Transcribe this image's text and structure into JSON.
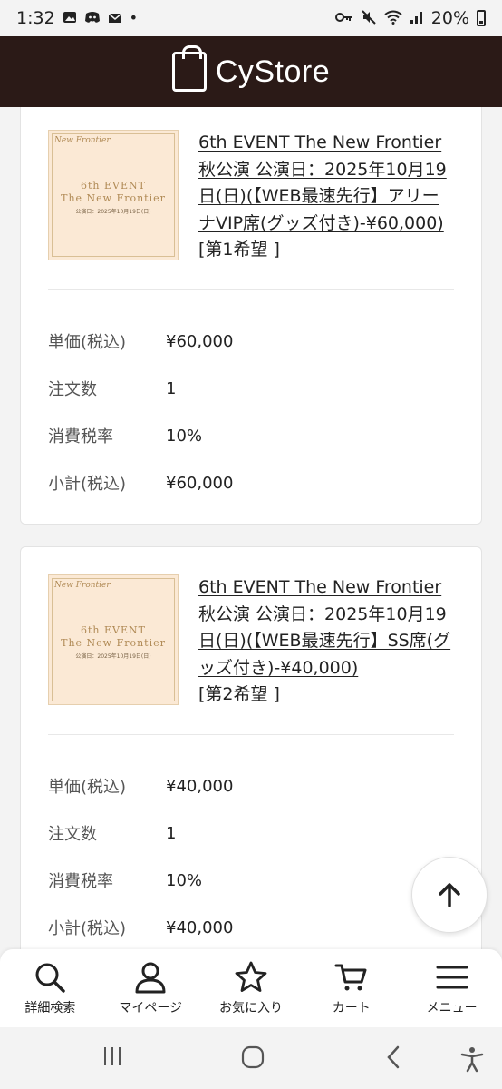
{
  "status": {
    "time": "1:32",
    "battery": "20%"
  },
  "header": {
    "logo_text": "CyStore"
  },
  "items": [
    {
      "title": "6th EVENT The New Frontier 秋公演 公演日：2025年10月19日(日)(【WEB最速先行】アリーナVIP席(グッズ付き)-¥60,000)",
      "choice": "[第1希望 ]",
      "thumb": {
        "brand": "New Frontier",
        "line1": "6th EVENT",
        "line2": "The New Frontier",
        "line3": "公演日：2025年10月19日(日)"
      },
      "rows": [
        {
          "key": "単価(税込)",
          "value": "¥60,000"
        },
        {
          "key": "注文数",
          "value": "1"
        },
        {
          "key": "消費税率",
          "value": "10%"
        },
        {
          "key": "小計(税込)",
          "value": "¥60,000"
        }
      ]
    },
    {
      "title": "6th EVENT The New Frontier 秋公演 公演日：2025年10月19日(日)(【WEB最速先行】SS席(グッズ付き)-¥40,000)",
      "choice": "[第2希望 ]",
      "thumb": {
        "brand": "New Frontier",
        "line1": "6th EVENT",
        "line2": "The New Frontier",
        "line3": "公演日：2025年10月19日(日)"
      },
      "rows": [
        {
          "key": "単価(税込)",
          "value": "¥40,000"
        },
        {
          "key": "注文数",
          "value": "1"
        },
        {
          "key": "消費税率",
          "value": "10%"
        },
        {
          "key": "小計(税込)",
          "value": "¥40,000"
        }
      ]
    }
  ],
  "bottom_nav": [
    {
      "label": "詳細検索",
      "icon": "search-icon"
    },
    {
      "label": "マイページ",
      "icon": "user-icon"
    },
    {
      "label": "お気に入り",
      "icon": "star-icon"
    },
    {
      "label": "カート",
      "icon": "cart-icon"
    },
    {
      "label": "メニュー",
      "icon": "menu-icon"
    }
  ],
  "colors": {
    "header_bg": "#2b1a17",
    "page_bg": "#f3f3f3"
  }
}
